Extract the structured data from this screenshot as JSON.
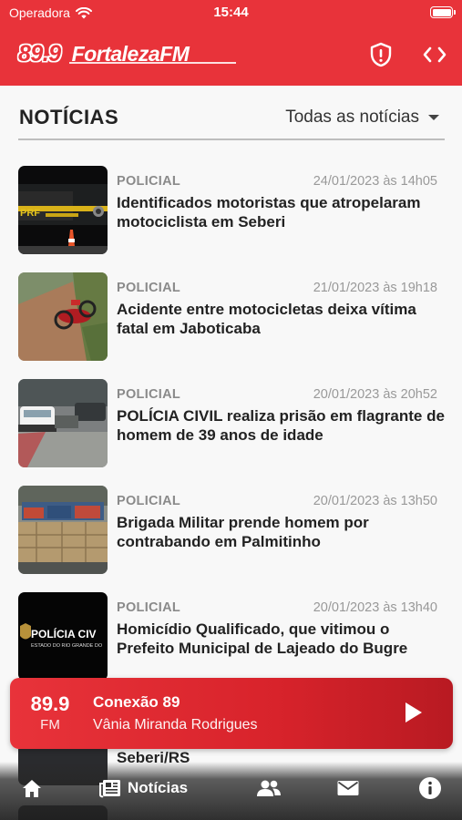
{
  "status_bar": {
    "carrier": "Operadora",
    "time": "15:44"
  },
  "header": {
    "logo_frequency": "89.9",
    "logo_name": "FortalezaFM",
    "icons": [
      "shield-alert-icon",
      "code-brackets-icon"
    ]
  },
  "section": {
    "title": "NOTÍCIAS",
    "filter_label": "Todas as notícias"
  },
  "news": [
    {
      "category": "POLICIAL",
      "date": "24/01/2023 às 14h05",
      "headline": "Identificados motoristas que atropelaram motociclista em Seberi"
    },
    {
      "category": "POLICIAL",
      "date": "21/01/2023 às 19h18",
      "headline": "Acidente entre motocicletas deixa vítima fatal em Jaboticaba"
    },
    {
      "category": "POLICIAL",
      "date": "20/01/2023 às 20h52",
      "headline": "POLÍCIA CIVIL realiza prisão em flagrante de homem de 39 anos de idade"
    },
    {
      "category": "POLICIAL",
      "date": "20/01/2023 às 13h50",
      "headline": "Brigada Militar prende homem por contrabando em Palmitinho"
    },
    {
      "category": "POLICIAL",
      "date": "20/01/2023 às 13h40",
      "headline": "Homicídio Qualificado, que vitimou o Prefeito Municipal de Lajeado do Bugre"
    }
  ],
  "thumb_text": {
    "prf": "PRF",
    "policia_civil": "POLÍCIA CIV",
    "policia_civil_sub": "ESTADO DO RIO GRANDE DO"
  },
  "partial_item_text": "Seberi/RS",
  "player": {
    "frequency": "89.9",
    "band": "FM",
    "show": "Conexão 89",
    "host": "Vânia Miranda Rodrigues"
  },
  "tabbar": {
    "news_label": "Notícias"
  },
  "colors": {
    "brand_red": "#e8333a",
    "player_dark_red": "#b81a22"
  }
}
